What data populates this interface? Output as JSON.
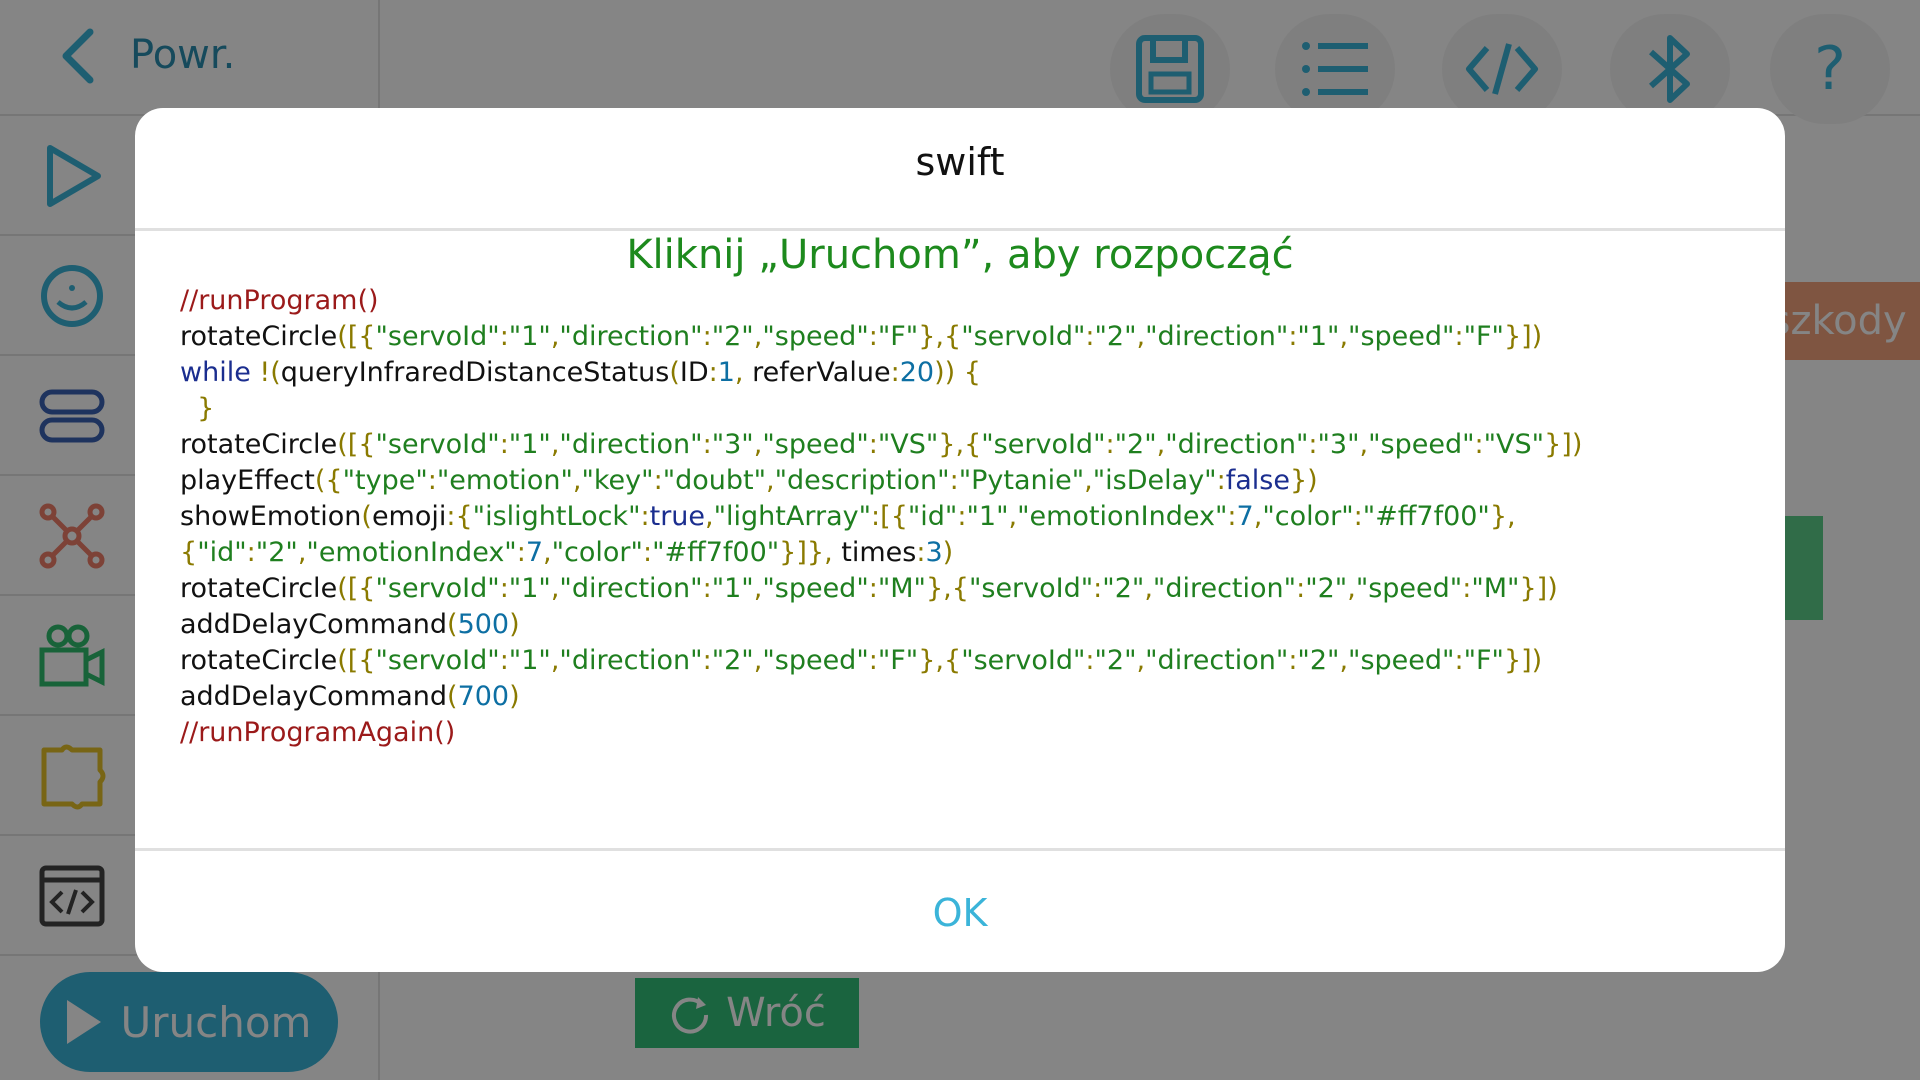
{
  "header": {
    "back_label": "Powr."
  },
  "toolbar": {
    "icons": [
      "save-icon",
      "list-icon",
      "code-icon",
      "bluetooth-icon",
      "help-icon"
    ],
    "help_glyph": "?"
  },
  "sidebar": {
    "items": [
      {
        "icon": "play-outline-icon",
        "color": "#3bb4d9"
      },
      {
        "icon": "smiley-icon",
        "color": "#3bb4d9"
      },
      {
        "icon": "toggle-icon",
        "color": "#3b62b4"
      },
      {
        "icon": "network-icon",
        "color": "#f07f6a"
      },
      {
        "icon": "camera-icon",
        "color": "#2fbf6d"
      },
      {
        "icon": "puzzle-icon",
        "color": "#e6c229"
      },
      {
        "icon": "code-window-icon",
        "color": "#444444"
      }
    ],
    "run_label": "Uruchom"
  },
  "canvas": {
    "orange_block_text": "eszkody",
    "back_block_label": "Wróć"
  },
  "dialog": {
    "title": "swift",
    "heading": "Kliknij „Uruchom”, aby rozpocząć",
    "ok_label": "OK",
    "code_lines": [
      "//runProgram()",
      "rotateCircle([{\"servoId\":\"1\",\"direction\":\"2\",\"speed\":\"F\"},{\"servoId\":\"2\",\"direction\":\"1\",\"speed\":\"F\"}])",
      "while !(queryInfraredDistanceStatus(ID:1, referValue:20)) {",
      "  }",
      "rotateCircle([{\"servoId\":\"1\",\"direction\":\"3\",\"speed\":\"VS\"},{\"servoId\":\"2\",\"direction\":\"3\",\"speed\":\"VS\"}])",
      "playEffect({\"type\":\"emotion\",\"key\":\"doubt\",\"description\":\"Pytanie\",\"isDelay\":false})",
      "showEmotion(emoji:{\"islightLock\":true,\"lightArray\":[{\"id\":\"1\",\"emotionIndex\":7,\"color\":\"#ff7f00\"},",
      "{\"id\":\"2\",\"emotionIndex\":7,\"color\":\"#ff7f00\"}]}, times:3)",
      "rotateCircle([{\"servoId\":\"1\",\"direction\":\"1\",\"speed\":\"M\"},{\"servoId\":\"2\",\"direction\":\"2\",\"speed\":\"M\"}])",
      "addDelayCommand(500)",
      "rotateCircle([{\"servoId\":\"1\",\"direction\":\"2\",\"speed\":\"F\"},{\"servoId\":\"2\",\"direction\":\"2\",\"speed\":\"F\"}])",
      "addDelayCommand(700)",
      "//runProgramAgain()"
    ]
  },
  "colors": {
    "accent": "#3bb4d9",
    "heading_green": "#1d8a1d",
    "overlay": "rgba(0,0,0,0.48)"
  }
}
